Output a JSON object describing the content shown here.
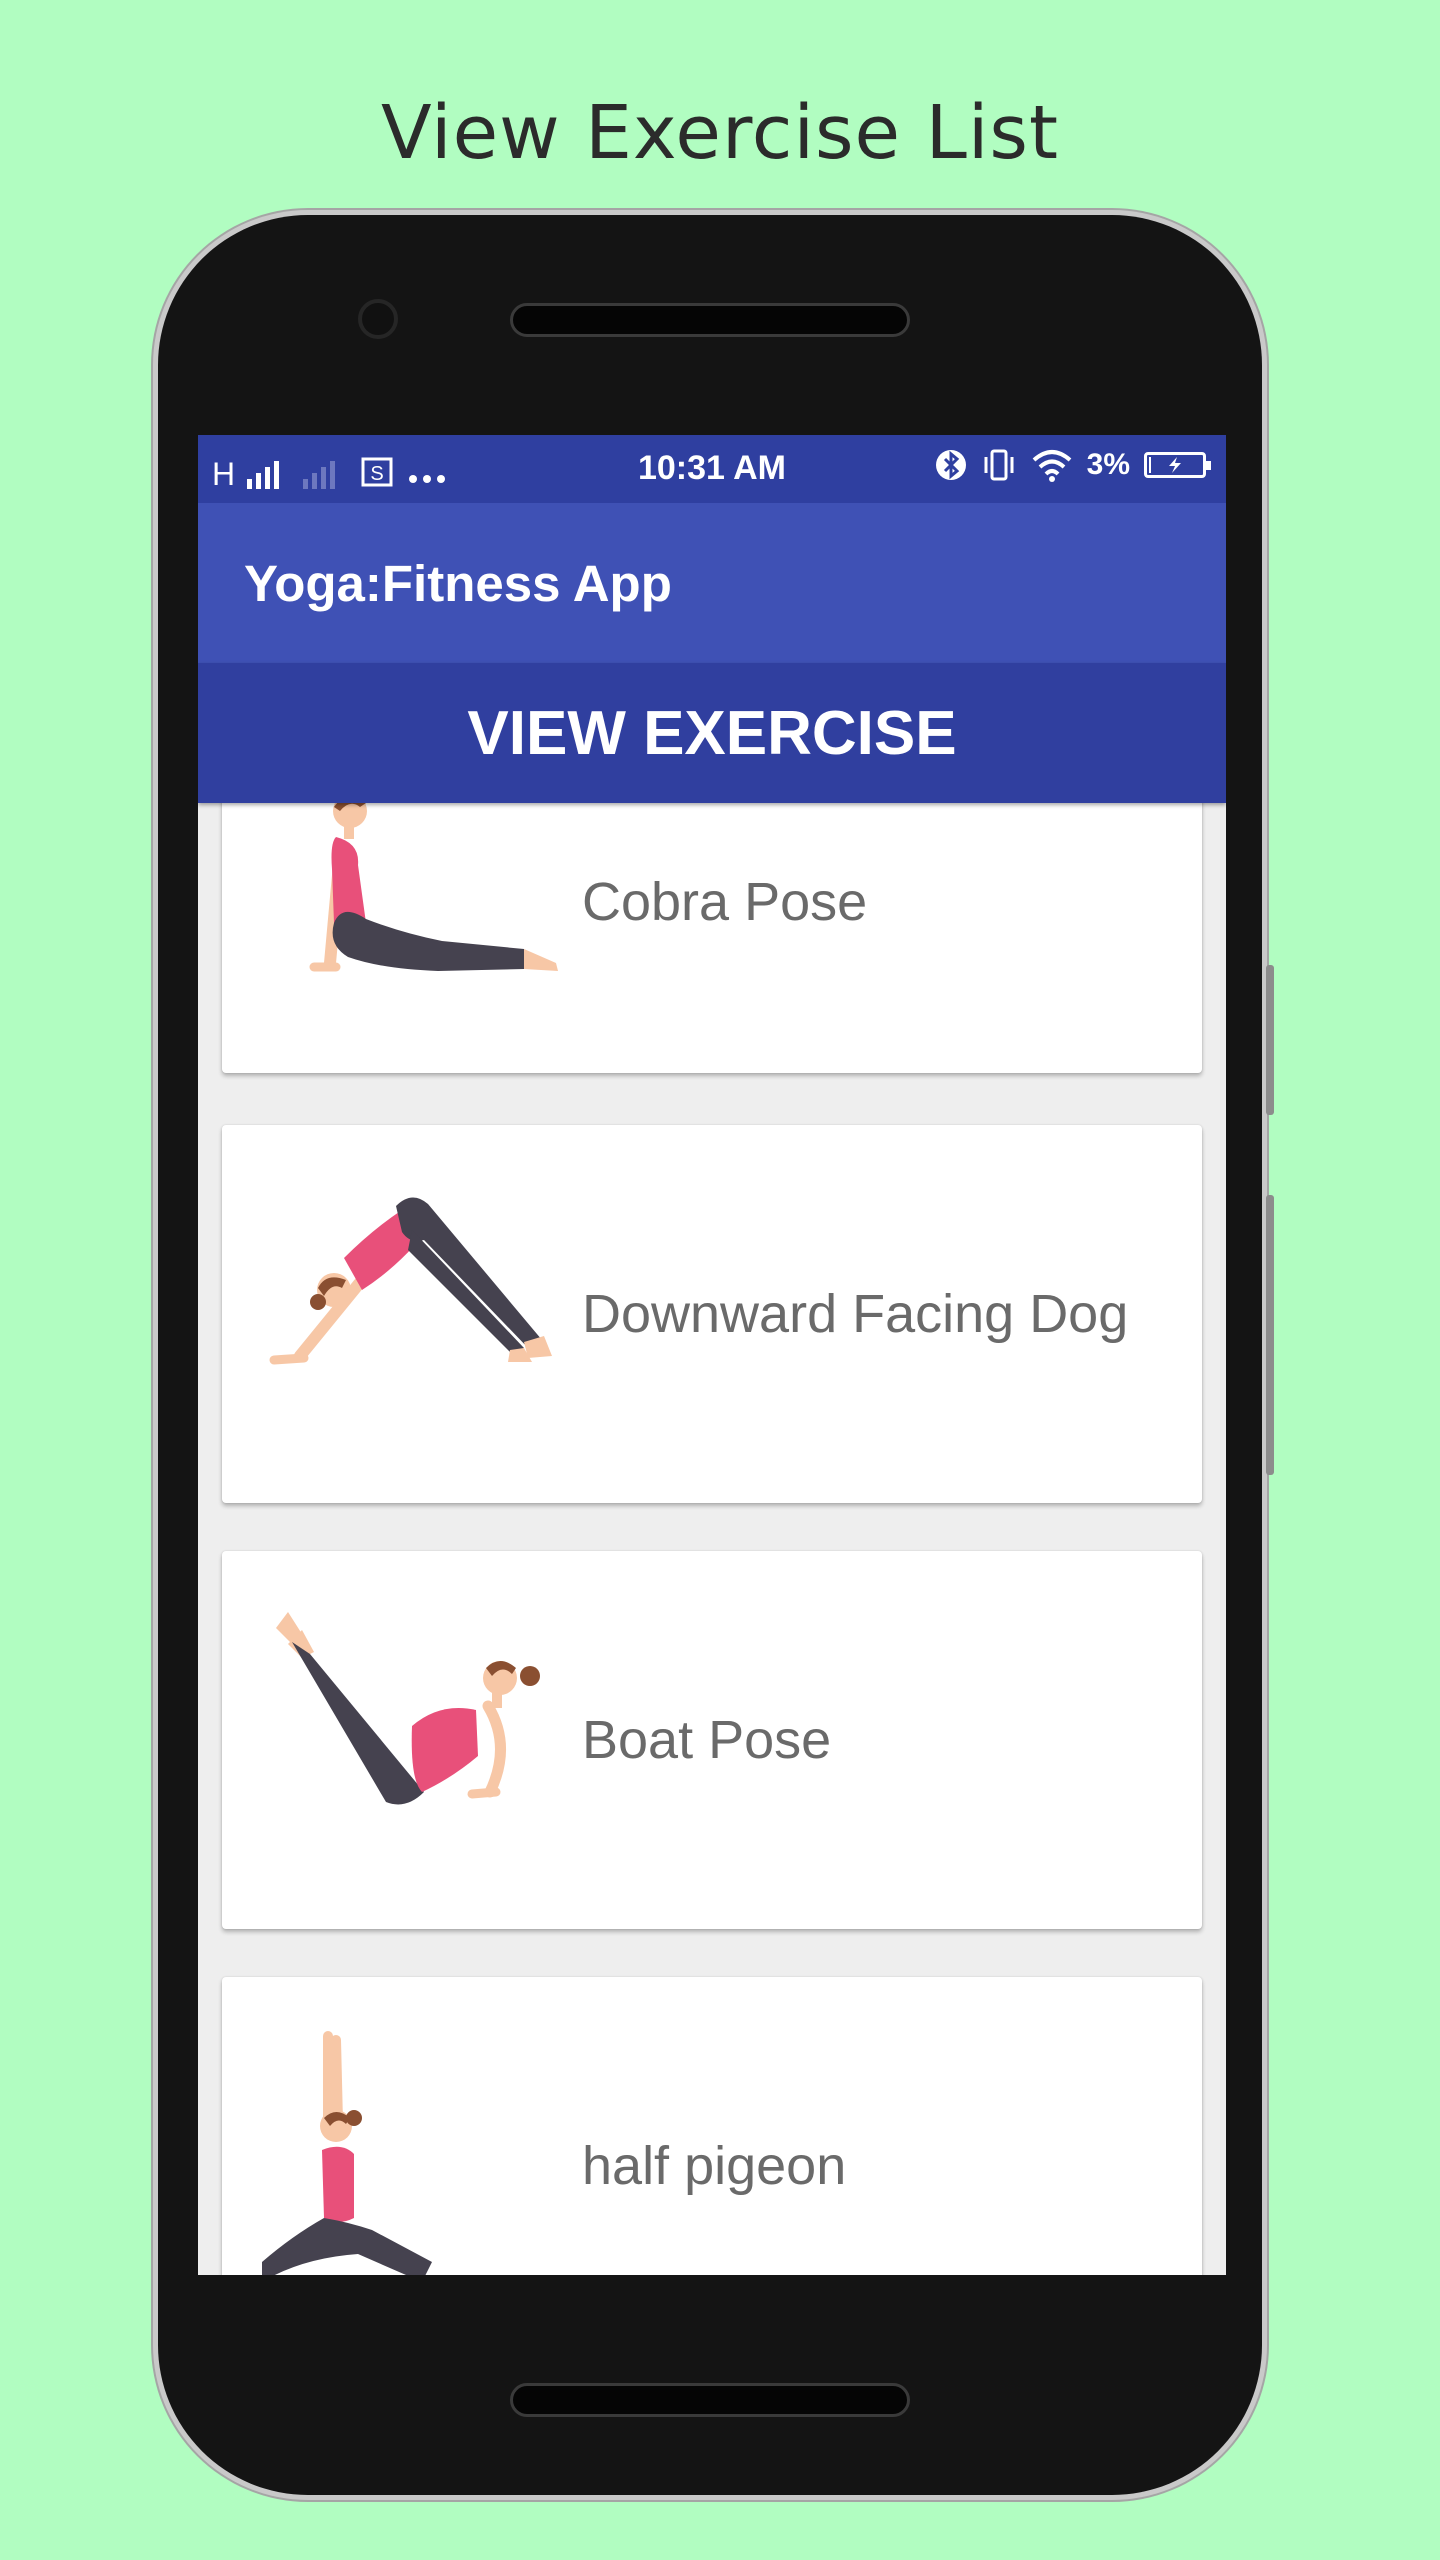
{
  "caption": "View Exercise List",
  "status_bar": {
    "network": "H",
    "time": "10:31 AM",
    "battery_text": "3%",
    "battery_level": 0.03
  },
  "app_bar": {
    "title": "Yoga:Fitness App"
  },
  "header_button": {
    "label": "VIEW EXERCISE"
  },
  "exercises": [
    {
      "name": "Cobra Pose",
      "pose_icon": "cobra-pose-figure"
    },
    {
      "name": "Downward Facing Dog",
      "pose_icon": "downward-dog-figure"
    },
    {
      "name": "Boat Pose",
      "pose_icon": "boat-pose-figure"
    },
    {
      "name": "half pigeon",
      "pose_icon": "half-pigeon-figure"
    }
  ],
  "colors": {
    "background": "#b1fdc1",
    "app_bar": "#3f51b5",
    "status_bar": "#2f3fa0",
    "header_button": "#303f9f",
    "shirt": "#e8507a",
    "pants": "#45424f",
    "skin": "#f7c7a6",
    "hair": "#8a4f31"
  }
}
